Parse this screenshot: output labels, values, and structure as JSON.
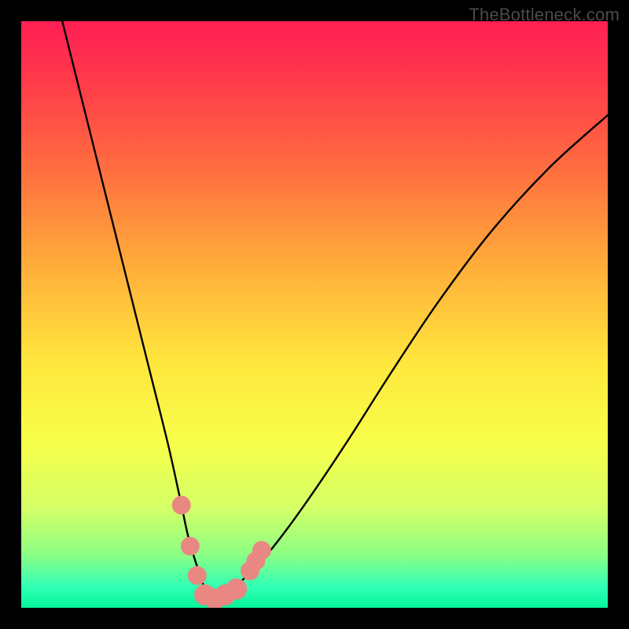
{
  "watermark": "TheBottleneck.com",
  "chart_data": {
    "type": "line",
    "title": "",
    "xlabel": "",
    "ylabel": "",
    "xlim": [
      0,
      100
    ],
    "ylim": [
      0,
      100
    ],
    "series": [
      {
        "name": "bottleneck-curve",
        "x": [
          7,
          10,
          13,
          16,
          19,
          22,
          25,
          27,
          28.5,
          30,
          31,
          32,
          33,
          34,
          36,
          38,
          41,
          45,
          50,
          56,
          63,
          71,
          80,
          90,
          100
        ],
        "y": [
          100,
          88,
          76,
          64,
          52,
          40,
          28,
          19,
          12,
          7,
          4,
          2,
          1.5,
          2,
          3,
          5,
          8,
          13,
          20,
          29,
          40,
          52,
          64,
          75,
          84
        ]
      }
    ],
    "markers": {
      "name": "highlight-points",
      "color": "#e98783",
      "points": [
        {
          "x": 27.3,
          "y": 17.5,
          "r": 1.6
        },
        {
          "x": 28.8,
          "y": 10.5,
          "r": 1.6
        },
        {
          "x": 30.0,
          "y": 5.5,
          "r": 1.6
        },
        {
          "x": 31.3,
          "y": 2.2,
          "r": 1.8
        },
        {
          "x": 33.0,
          "y": 1.5,
          "r": 1.8
        },
        {
          "x": 34.8,
          "y": 2.2,
          "r": 1.8
        },
        {
          "x": 36.7,
          "y": 3.2,
          "r": 1.8
        },
        {
          "x": 39.0,
          "y": 6.3,
          "r": 1.6
        },
        {
          "x": 40.0,
          "y": 8.0,
          "r": 1.6
        },
        {
          "x": 41.0,
          "y": 9.8,
          "r": 1.6
        }
      ]
    },
    "gradient_stops": [
      {
        "offset": 0.0,
        "color": "#ff1f54"
      },
      {
        "offset": 0.1,
        "color": "#ff3a4a"
      },
      {
        "offset": 0.25,
        "color": "#ff6d3f"
      },
      {
        "offset": 0.42,
        "color": "#ffae3a"
      },
      {
        "offset": 0.58,
        "color": "#ffe63d"
      },
      {
        "offset": 0.72,
        "color": "#f7ff4a"
      },
      {
        "offset": 0.83,
        "color": "#d4ff67"
      },
      {
        "offset": 0.91,
        "color": "#8bff84"
      },
      {
        "offset": 0.965,
        "color": "#2fffb6"
      },
      {
        "offset": 1.0,
        "color": "#05f59a"
      }
    ]
  }
}
